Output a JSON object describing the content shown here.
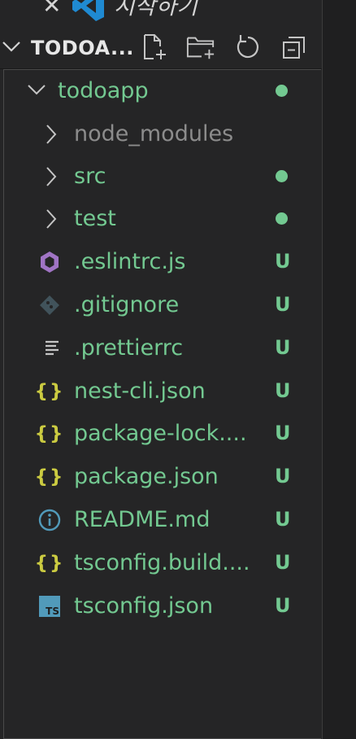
{
  "open_editor": {
    "close_symbol": "✕",
    "label": "시작하기",
    "logo_icon": "vscode-logo-icon"
  },
  "explorer": {
    "section_title": "TODOA...",
    "actions": [
      "new-file-icon",
      "new-folder-icon",
      "refresh-icon",
      "collapse-all-icon"
    ]
  },
  "tree": {
    "root_folder": {
      "label": "todoapp",
      "status": "modified-dot"
    },
    "folders": [
      {
        "label": "node_modules",
        "status": "ignored"
      },
      {
        "label": "src",
        "status": "modified-dot"
      },
      {
        "label": "test",
        "status": "modified-dot"
      }
    ],
    "files": [
      {
        "label": ".eslintrc.js",
        "icon": "eslint-icon",
        "badge": "U"
      },
      {
        "label": ".gitignore",
        "icon": "git-icon",
        "badge": "U"
      },
      {
        "label": ".prettierrc",
        "icon": "lines-icon",
        "badge": "U"
      },
      {
        "label": "nest-cli.json",
        "icon": "json-braces-icon",
        "icon_text": "{}",
        "badge": "U"
      },
      {
        "label": "package-lock....",
        "icon": "json-braces-icon",
        "icon_text": "{}",
        "badge": "U"
      },
      {
        "label": "package.json",
        "icon": "json-braces-icon",
        "icon_text": "{}",
        "badge": "U"
      },
      {
        "label": "README.md",
        "icon": "info-icon",
        "badge": "U"
      },
      {
        "label": "tsconfig.build....",
        "icon": "json-braces-icon",
        "icon_text": "{}",
        "badge": "U"
      },
      {
        "label": "tsconfig.json",
        "icon": "typescript-icon",
        "icon_text": "TS",
        "badge": "U"
      }
    ]
  },
  "colors": {
    "untracked": "#73c991",
    "ignored": "#8c8c8c",
    "json_icon": "#cbcb41",
    "eslint": "#a074c4",
    "info": "#519aba",
    "typescript": "#519aba",
    "git": "#41535b",
    "background": "#252526"
  }
}
